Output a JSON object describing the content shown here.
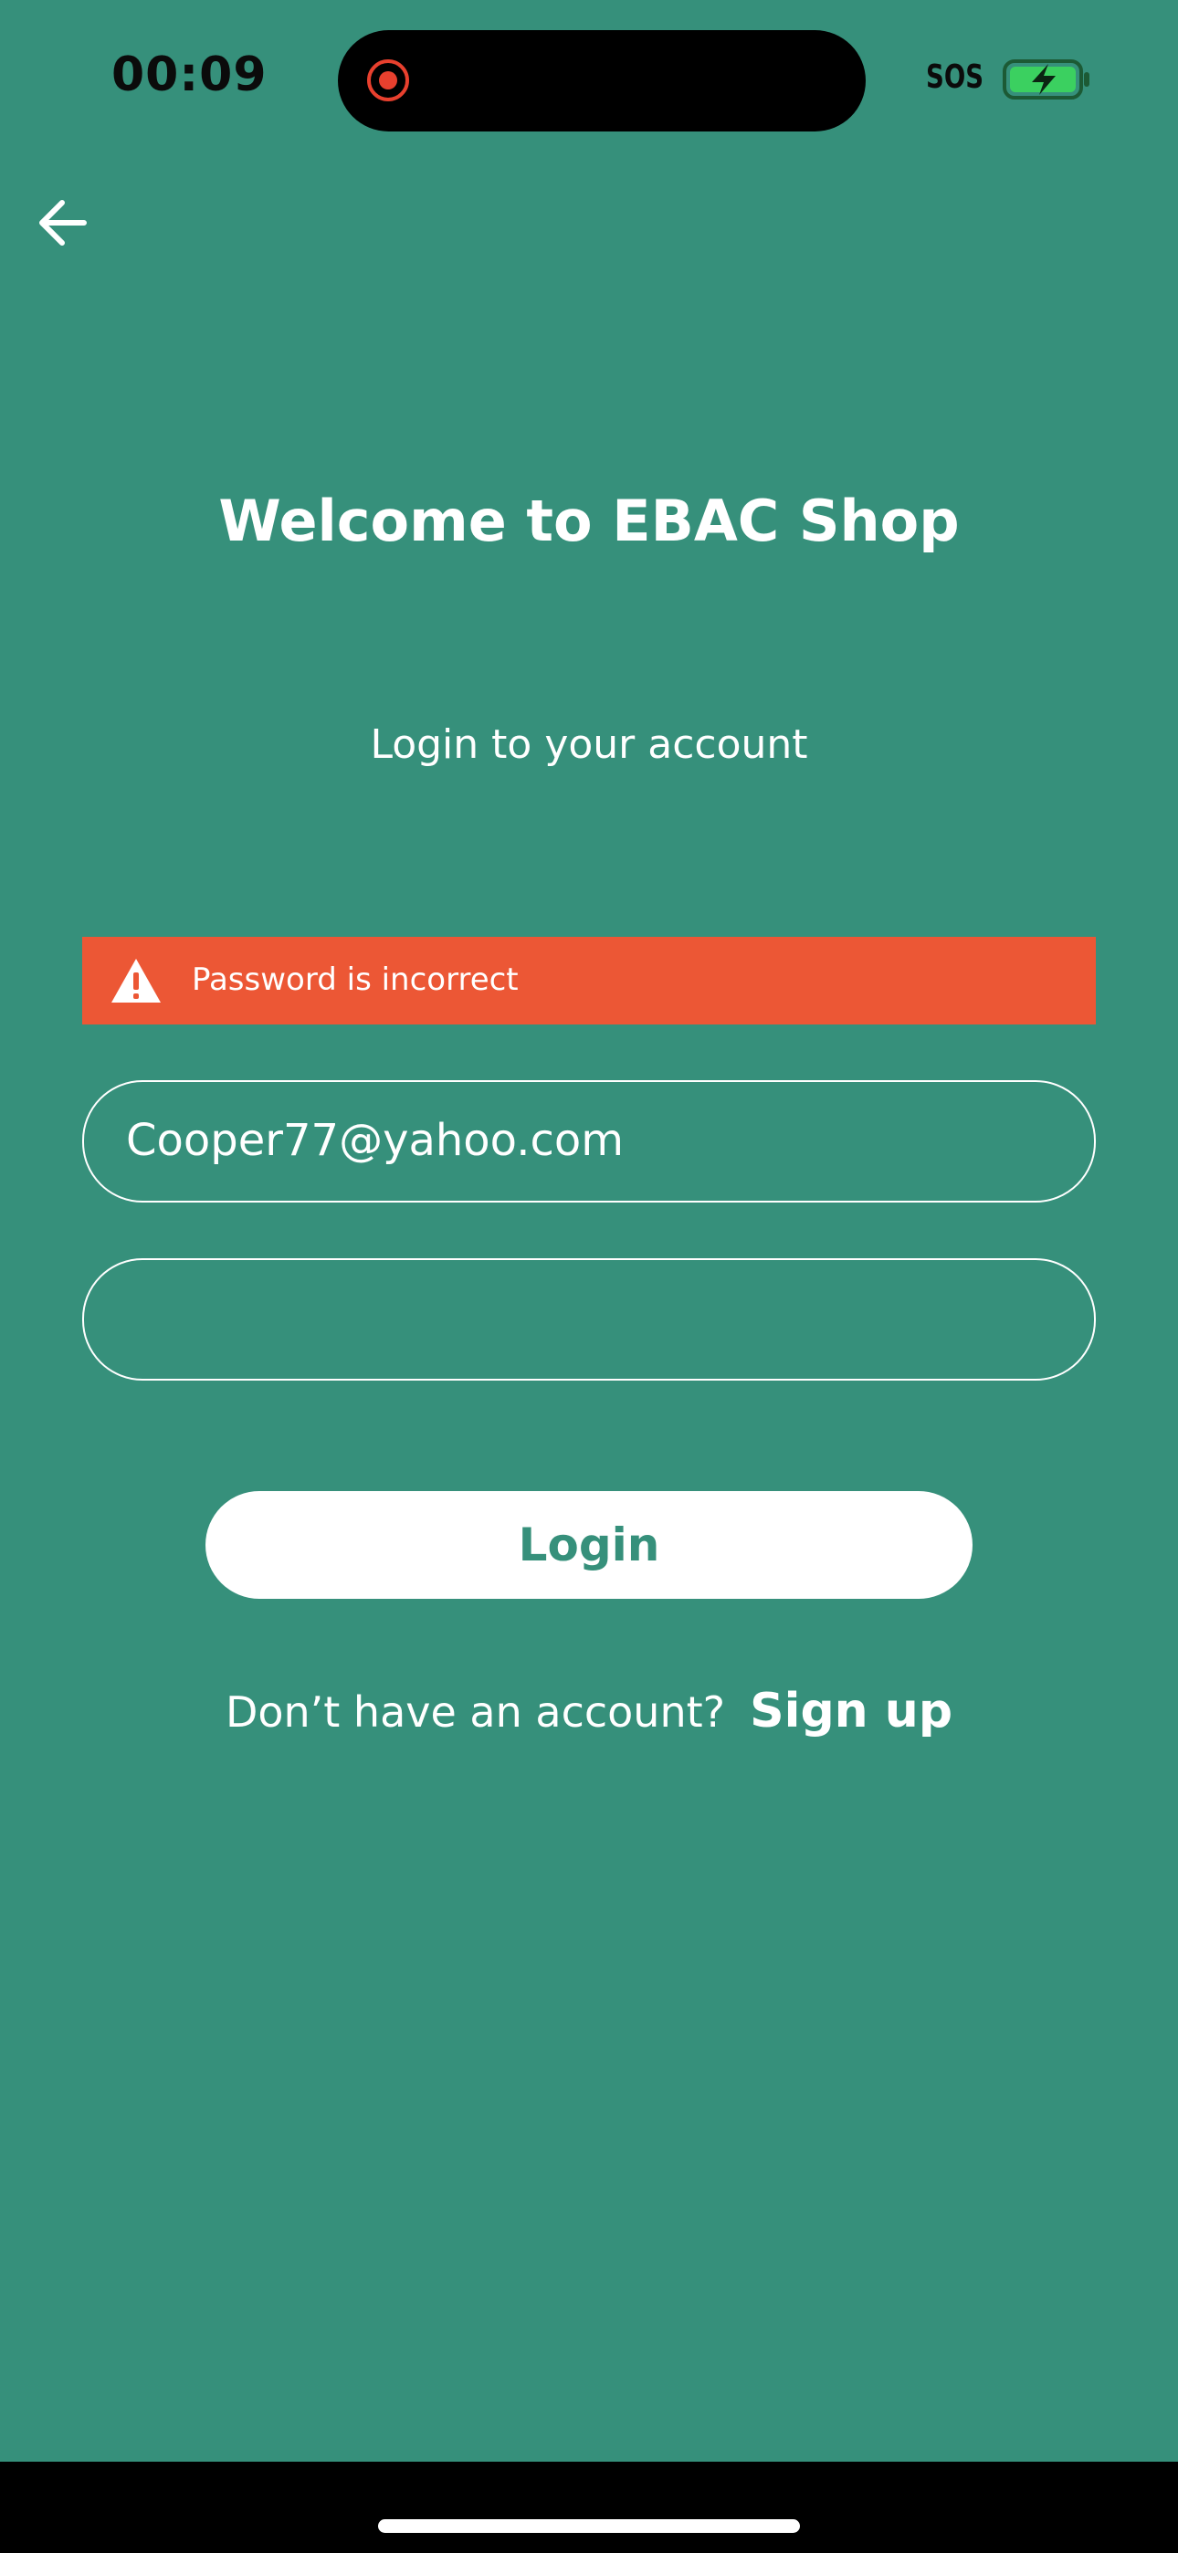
{
  "status_bar": {
    "time": "00:09",
    "sos": "SOS",
    "icons": [
      "screen-recording-icon",
      "battery-charging-icon"
    ]
  },
  "nav": {
    "back_icon": "arrow-left-icon"
  },
  "header": {
    "title": "Welcome to EBAC Shop",
    "subtitle": "Login to your account"
  },
  "error": {
    "icon": "warning-icon",
    "message": "Password is incorrect",
    "color": "#ec5735"
  },
  "form": {
    "email_value": "Cooper77@yahoo.com",
    "password_value": "",
    "login_label": "Login"
  },
  "signup": {
    "prompt": "Don’t have an account?",
    "link_label": "Sign up"
  },
  "colors": {
    "background": "#36907b",
    "accent_text": "#36907b",
    "error": "#ec5735"
  }
}
